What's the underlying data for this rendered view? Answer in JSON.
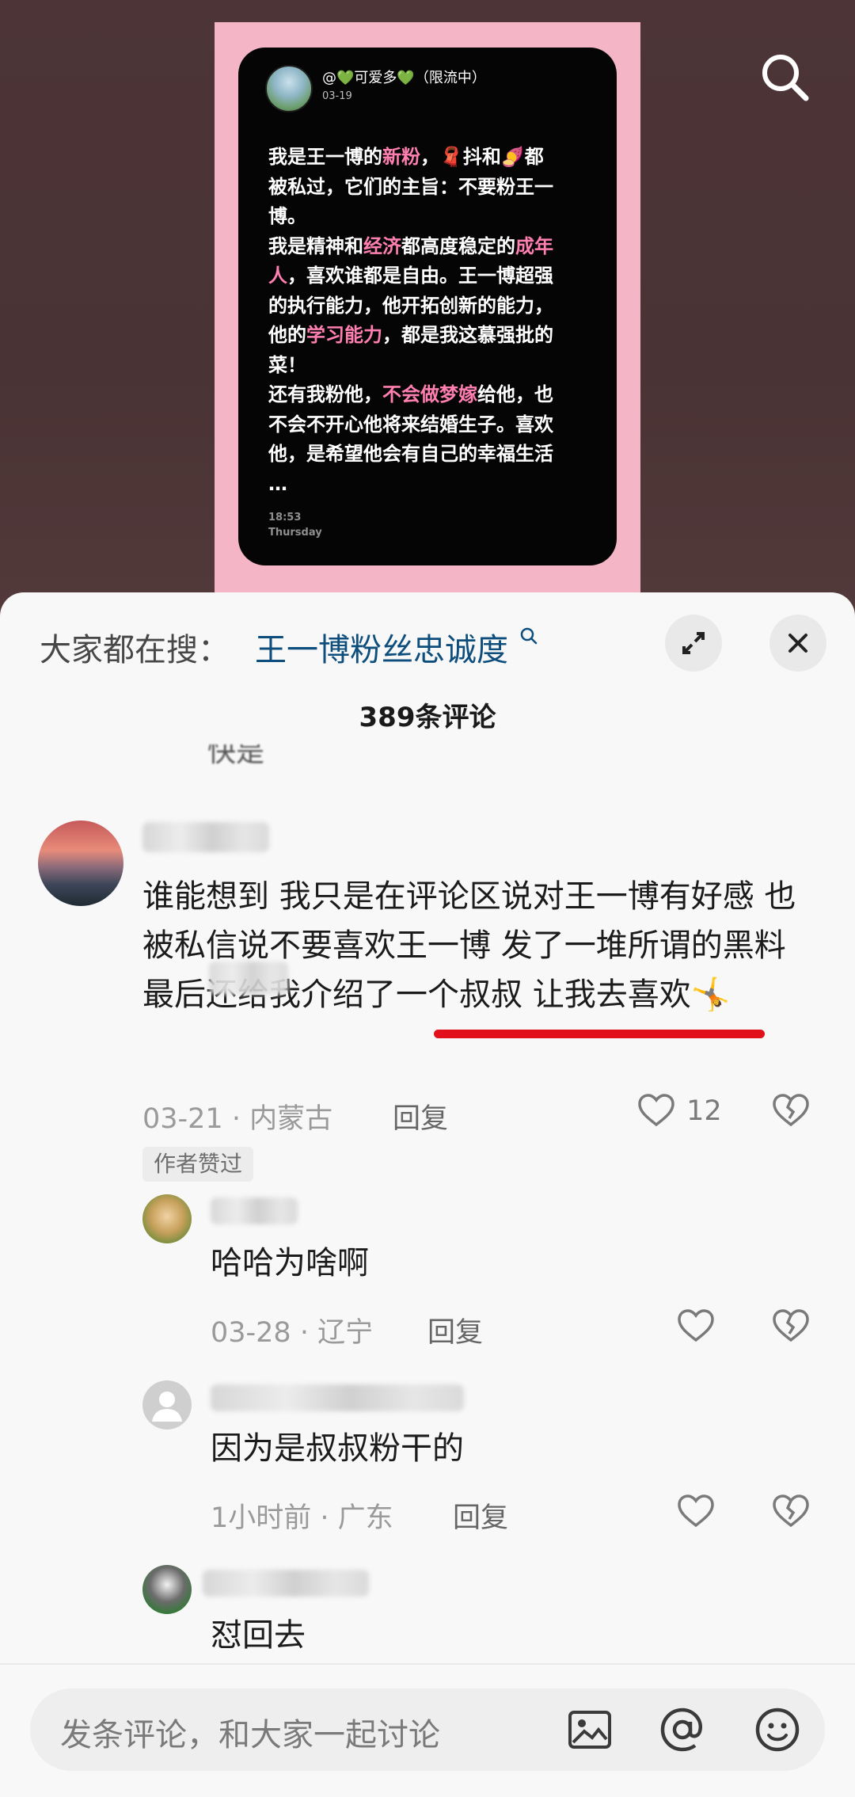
{
  "post": {
    "user": "@💚可爱多💚（限流中）",
    "date": "03-19",
    "time": "18:53",
    "weekday": "Thursday",
    "lines": [
      [
        {
          "t": "我是王一博的"
        },
        {
          "t": "新粉",
          "pink": true
        },
        {
          "t": "，🧣抖和🍠都"
        }
      ],
      [
        {
          "t": "被私过，它们的主旨：不要粉王一"
        }
      ],
      [
        {
          "t": "博。"
        }
      ],
      [
        {
          "t": "我是精神和"
        },
        {
          "t": "经济",
          "pink": true
        },
        {
          "t": "都高度稳定的"
        },
        {
          "t": "成年",
          "pink": true
        }
      ],
      [
        {
          "t": "人",
          "pink": true
        },
        {
          "t": "，喜欢谁都是自由。王一博超强"
        }
      ],
      [
        {
          "t": "的执行能力，他开拓创新的能力，"
        }
      ],
      [
        {
          "t": "他的"
        },
        {
          "t": "学习能力",
          "pink": true
        },
        {
          "t": "，都是我这慕强批的"
        }
      ],
      [
        {
          "t": "菜！"
        }
      ],
      [
        {
          "t": "还有我粉他，"
        },
        {
          "t": "不会做梦嫁",
          "pink": true
        },
        {
          "t": "给他，也"
        }
      ],
      [
        {
          "t": "不会不开心他将来结婚生子。喜欢"
        }
      ],
      [
        {
          "t": "他，是希望他会有自己的幸福生活"
        }
      ],
      [
        {
          "t": "…"
        }
      ]
    ]
  },
  "sheet": {
    "hot_prefix": "大家都在搜：",
    "hot_term": "王一博粉丝忠诚度",
    "comment_count": "389条评论",
    "partial_text": "快是"
  },
  "comment": {
    "text": "谁能想到 我只是在评论区说对王一博有好感 也被私信说不要喜欢王一博 发了一堆所谓的黑料 最后还给我介绍了一个叔叔 让我去喜欢🤸",
    "date": "03-21",
    "location": "内蒙古",
    "reply_label": "回复",
    "likes": "12",
    "author_liked": "作者赞过"
  },
  "replies": [
    {
      "text": "哈哈为啥啊",
      "date": "03-28",
      "location": "辽宁",
      "reply_label": "回复"
    },
    {
      "text": "因为是叔叔粉干的",
      "date": "1小时前",
      "location": "广东",
      "reply_label": "回复"
    },
    {
      "text": "怼回去"
    }
  ],
  "input": {
    "placeholder": "发条评论，和大家一起讨论"
  },
  "icons": {
    "search": "search-icon",
    "expand": "expand-icon",
    "close": "close-icon",
    "like": "heart-icon",
    "dislike": "broken-heart-icon",
    "image": "image-icon",
    "mention": "at-icon",
    "emoji": "emoji-icon"
  },
  "colors": {
    "accent_link": "#0e4e7d",
    "underline": "#e1101a",
    "pink_highlight": "#ff7fb0",
    "poster_bg": "#f4b6c6"
  }
}
